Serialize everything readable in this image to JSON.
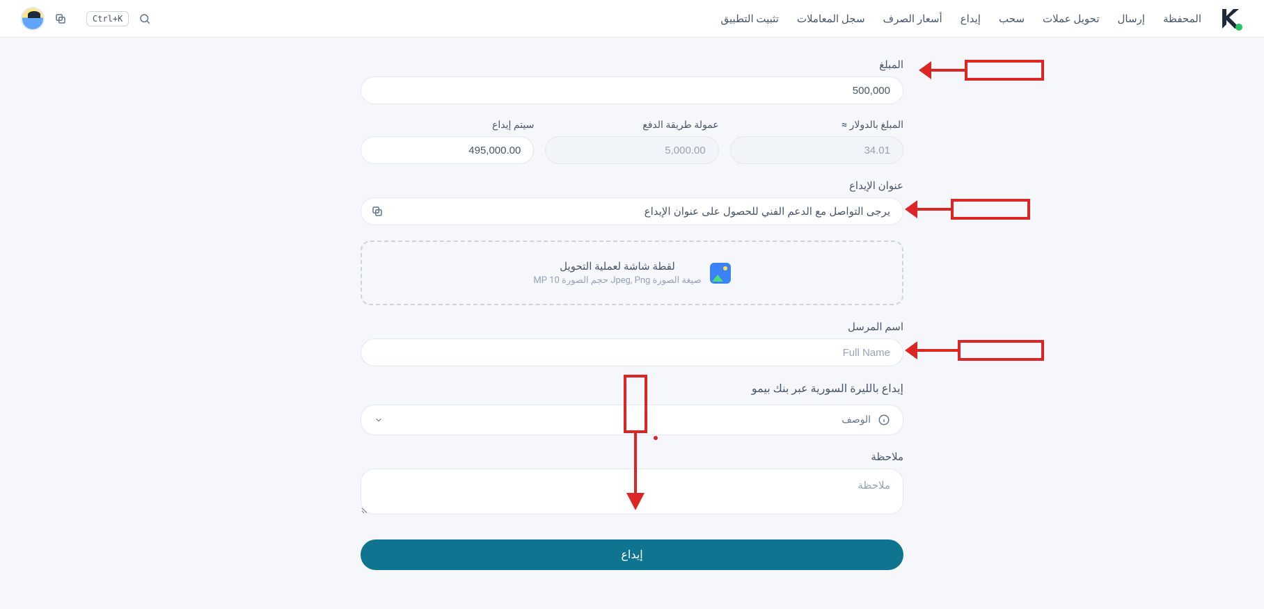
{
  "header": {
    "nav": [
      "المحفظة",
      "إرسال",
      "تحويل عملات",
      "سحب",
      "إيداع",
      "أسعار الصرف",
      "سجل المعاملات",
      "تثبيت التطبيق"
    ],
    "shortcut": "Ctrl+K"
  },
  "form": {
    "amount_label": "المبلغ",
    "amount_value": "500,000",
    "usd_label": "المبلغ بالدولار ≈",
    "usd_value": "34.01",
    "fee_label": "عمولة طريقة الدفع",
    "fee_value": "5,000.00",
    "net_label": "سيتم إيداع",
    "net_value": "495,000.00",
    "address_label": "عنوان الإيداع",
    "address_value": "يرجى التواصل مع الدعم الفني للحصول على عنوان الإيداع",
    "upload_title": "لقطة شاشة لعملية التحويل",
    "upload_hint": "صيغة الصورة Jpeg, Png حجم الصورة 10 MP",
    "sender_label": "اسم المرسل",
    "sender_placeholder": "Full Name",
    "section_title": "إيداع بالليرة السورية عبر بنك بيمو",
    "desc_label": "الوصف",
    "note_label": "ملاحظة",
    "note_placeholder": "ملاحظة",
    "submit_label": "إيداع"
  }
}
